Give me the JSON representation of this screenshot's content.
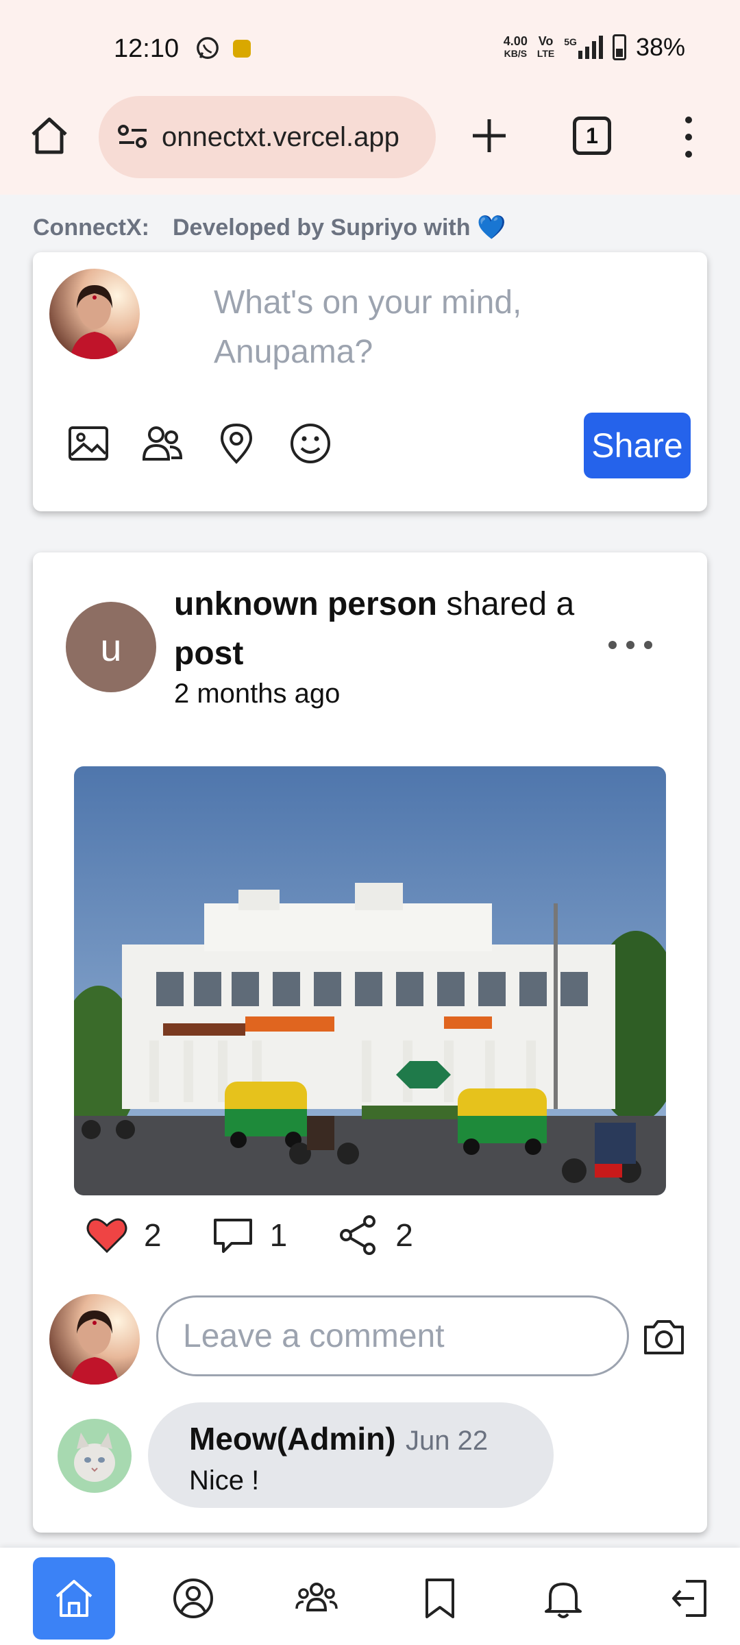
{
  "status_bar": {
    "time": "12:10",
    "net_speed": "4.00",
    "net_unit": "KB/S",
    "volte_top": "Vo",
    "volte_bottom": "LTE",
    "network": "5G",
    "battery": "38%"
  },
  "browser": {
    "url": "onnectxt.vercel.app",
    "tab_count": "1"
  },
  "app": {
    "brand": "ConnectX:",
    "tagline": "Developed by Supriyo with 💙"
  },
  "composer": {
    "placeholder": "What's on your mind, Anupama?",
    "share_label": "Share",
    "tools": [
      "image-icon",
      "tag-people-icon",
      "location-icon",
      "emoji-icon"
    ]
  },
  "post": {
    "avatar_letter": "u",
    "author": "unknown person",
    "action_plain": "shared a",
    "action_bold": "post",
    "time": "2 months ago",
    "likes": "2",
    "comments": "1",
    "shares": "2",
    "comment_placeholder": "Leave a comment"
  },
  "comment": {
    "name": "Meow(Admin)",
    "date": "Jun 22",
    "text": "Nice !"
  },
  "bottom_nav": [
    "home-icon",
    "profile-icon",
    "friends-icon",
    "bookmark-icon",
    "notifications-icon",
    "logout-icon"
  ],
  "colors": {
    "accent": "#2563eb",
    "nav_active": "#3b82f6",
    "like": "#ef4444",
    "avatar_u": "#8d6e63",
    "browser_bar": "#fdf1ee"
  }
}
